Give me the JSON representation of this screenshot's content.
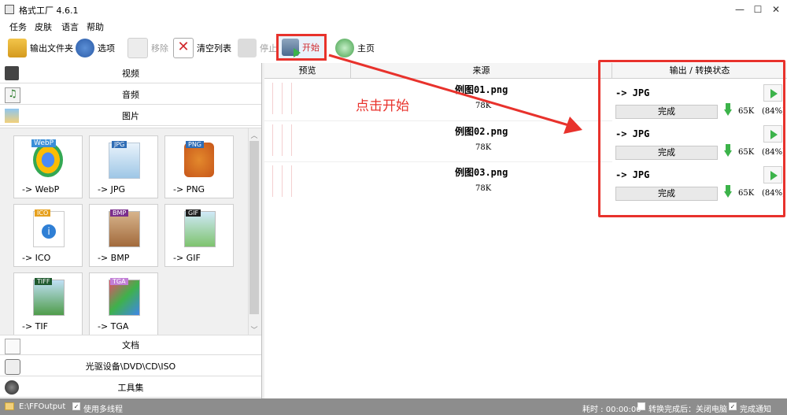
{
  "window": {
    "title": "格式工厂 4.6.1",
    "controls": [
      "—",
      "☐",
      "✕"
    ]
  },
  "menu": [
    "任务",
    "皮肤",
    "语言",
    "帮助"
  ],
  "toolbar": {
    "output_folder": "输出文件夹",
    "options": "选项",
    "remove": "移除",
    "clear_list": "清空列表",
    "stop": "停止",
    "start": "开始",
    "home": "主页"
  },
  "categories": {
    "video": "视频",
    "audio": "音频",
    "image": "图片",
    "document": "文档",
    "optical": "光驱设备\\DVD\\CD\\ISO",
    "tools": "工具集"
  },
  "formats": [
    {
      "label": "-> WebP",
      "badge": "WebP",
      "color": "#3b8fd9"
    },
    {
      "label": "-> JPG",
      "badge": "JPG",
      "color": "#2f6db5"
    },
    {
      "label": "-> PNG",
      "badge": "PNG",
      "color": "#2f6db5"
    },
    {
      "label": "-> ICO",
      "badge": "ICO",
      "color": "#e6a11f"
    },
    {
      "label": "-> BMP",
      "badge": "BMP",
      "color": "#7b2f8c"
    },
    {
      "label": "-> GIF",
      "badge": "GIF",
      "color": "#1f1f1f"
    },
    {
      "label": "-> TIF",
      "badge": "TIFF",
      "color": "#1f5a2f"
    },
    {
      "label": "-> TGA",
      "badge": "TGA",
      "color": "#c27fd6"
    }
  ],
  "table": {
    "headers": {
      "preview": "预览",
      "source": "来源",
      "output": "输出 / 转换状态"
    },
    "rows": [
      {
        "name": "例图01.png",
        "size": "78K",
        "target": "-> JPG",
        "status": "完成",
        "out_size": "65K",
        "ratio": "(84%)"
      },
      {
        "name": "例图02.png",
        "size": "78K",
        "target": "-> JPG",
        "status": "完成",
        "out_size": "65K",
        "ratio": "(84%)"
      },
      {
        "name": "例图03.png",
        "size": "78K",
        "target": "-> JPG",
        "status": "完成",
        "out_size": "65K",
        "ratio": "(84%)"
      }
    ]
  },
  "annotation": {
    "click_start": "点击开始",
    "accent": "#e8322c"
  },
  "status": {
    "path": "E:\\FFOutput",
    "multithread": "使用多线程",
    "elapsed": "耗时 : 00:00:00",
    "shutdown": "转换完成后：关闭电脑",
    "notify": "完成通知"
  }
}
